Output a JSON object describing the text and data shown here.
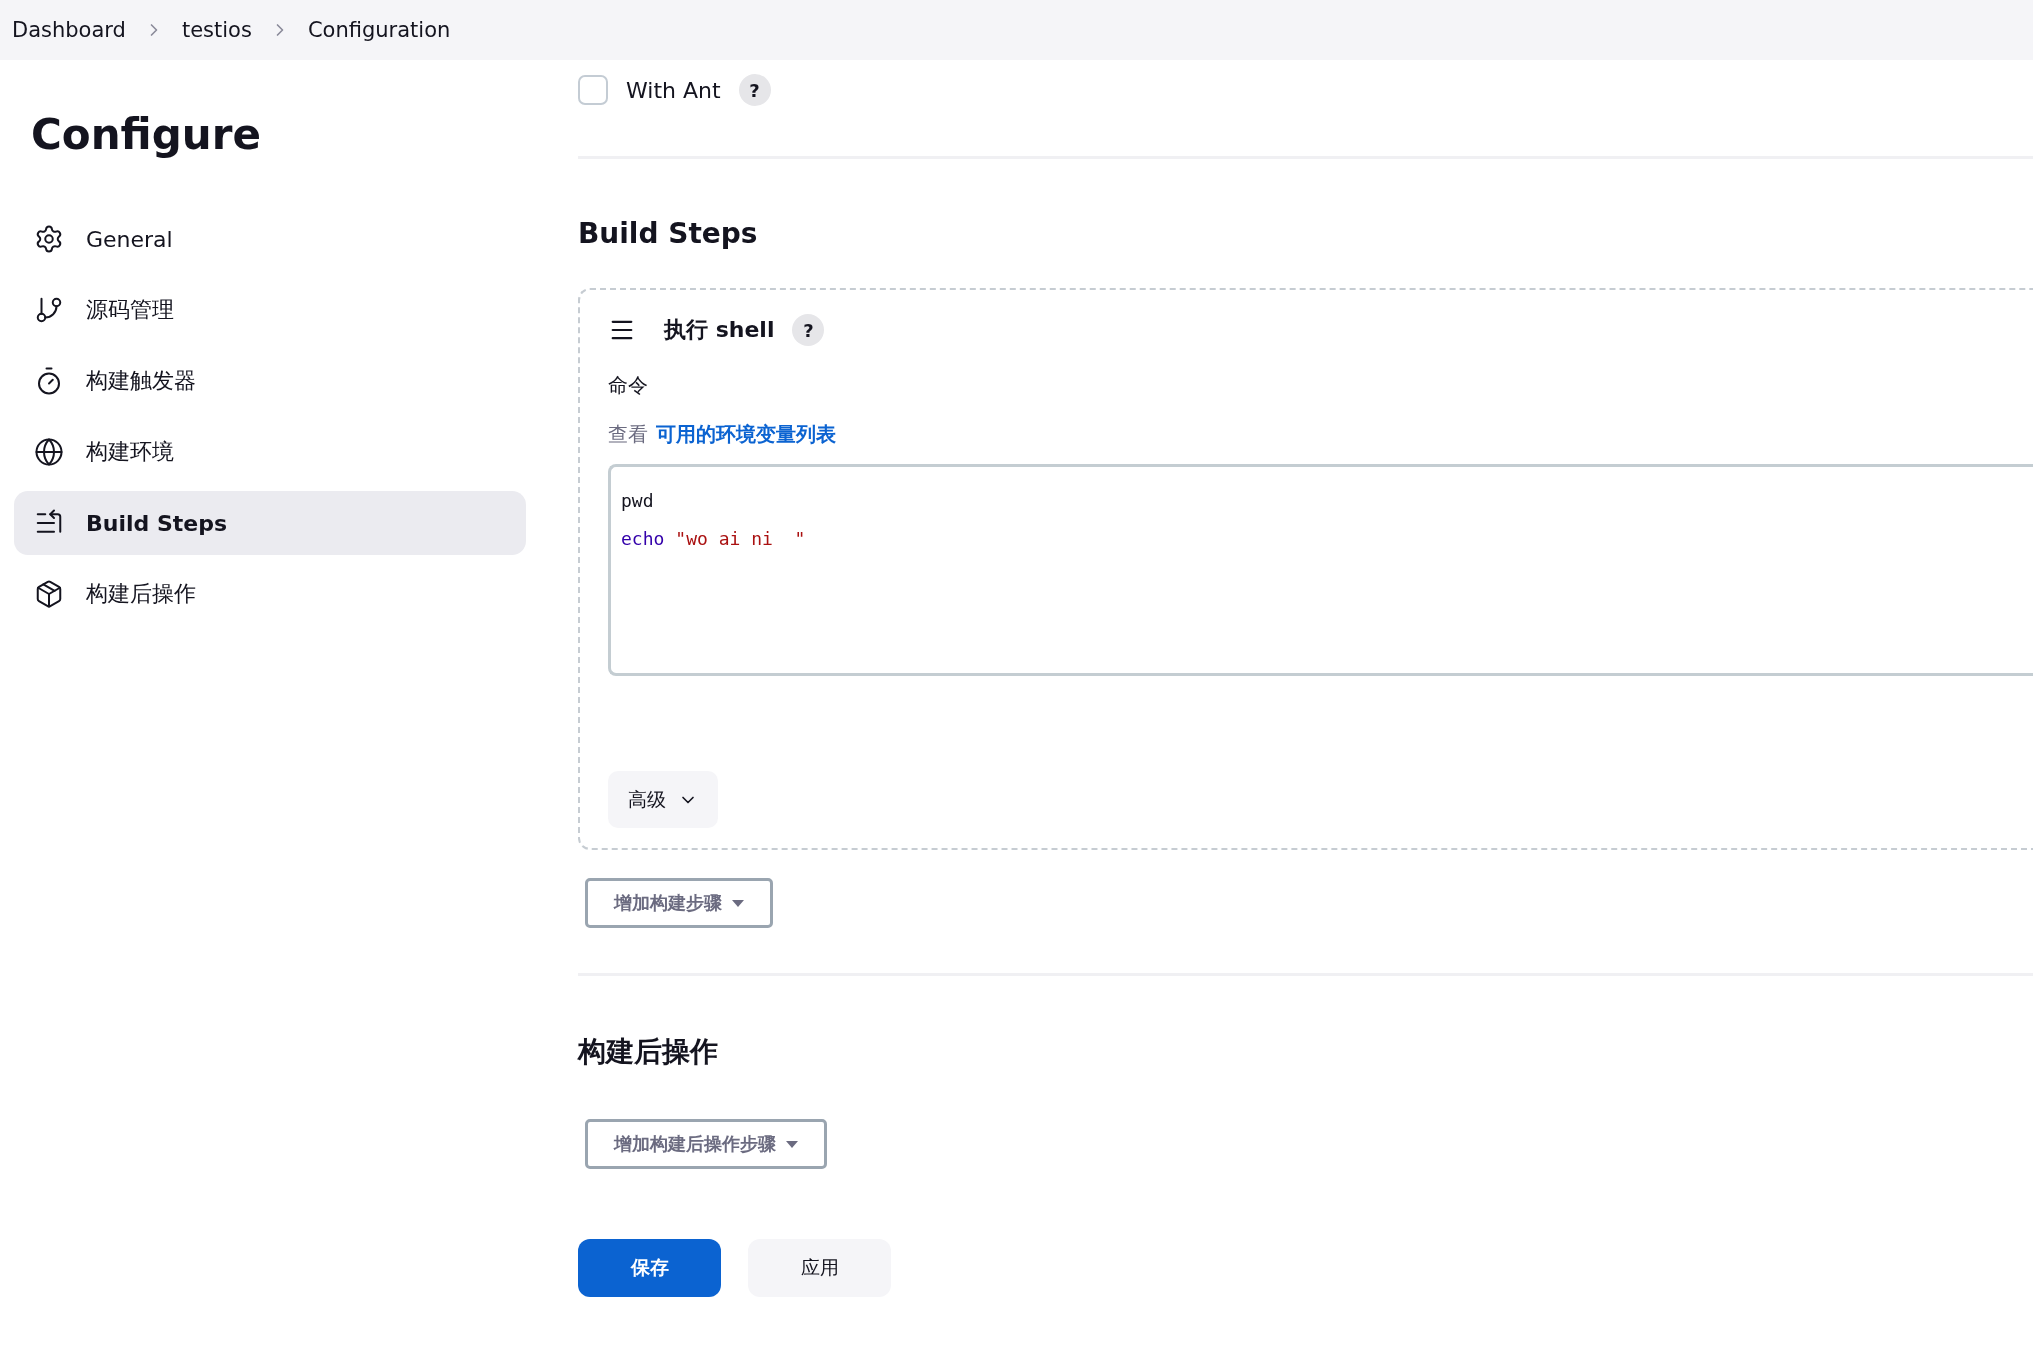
{
  "breadcrumbs": [
    {
      "label": "Dashboard"
    },
    {
      "label": "testios"
    },
    {
      "label": "Configuration"
    }
  ],
  "sidebar": {
    "title": "Configure",
    "items": [
      {
        "kind": "general",
        "label": "General",
        "selected": false
      },
      {
        "kind": "scm",
        "label": "源码管理",
        "selected": false
      },
      {
        "kind": "triggers",
        "label": "构建触发器",
        "selected": false
      },
      {
        "kind": "environment",
        "label": "构建环境",
        "selected": false
      },
      {
        "kind": "steps",
        "label": "Build Steps",
        "selected": true
      },
      {
        "kind": "post",
        "label": "构建后操作",
        "selected": false
      }
    ]
  },
  "with_ant": {
    "label": "With Ant",
    "checked": false,
    "help": "?"
  },
  "build_steps": {
    "title": "Build Steps",
    "step": {
      "title": "执行 shell",
      "help": "?",
      "command_label": "命令",
      "env_prefix": "查看",
      "env_link": "可用的环境变量列表",
      "code_lines": [
        [
          {
            "kind": "plain",
            "text": "pwd"
          }
        ],
        [
          {
            "kind": "keyword",
            "text": "echo"
          },
          {
            "kind": "string",
            "text": "\"wo ai ni  \""
          }
        ]
      ],
      "advanced": "高级"
    },
    "add_button": "增加构建步骤"
  },
  "post_build": {
    "title": "构建后操作",
    "add_button": "增加构建后操作步骤"
  },
  "actions": [
    {
      "kind": "primary",
      "label": "保存"
    },
    {
      "kind": "secondary",
      "label": "应用"
    }
  ]
}
